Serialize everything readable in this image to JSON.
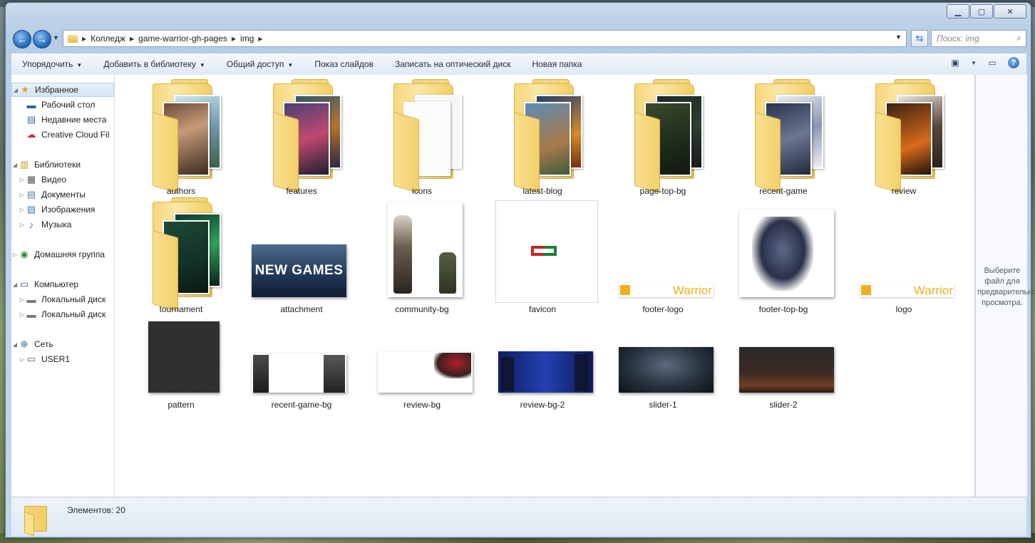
{
  "address": {
    "crumbs": [
      "Колледж",
      "game-warrior-gh-pages",
      "img"
    ]
  },
  "search": {
    "placeholder": "Поиск: img"
  },
  "toolbar": {
    "organize": "Упорядочить",
    "add_to_library": "Добавить в библиотеку",
    "share": "Общий доступ",
    "slideshow": "Показ слайдов",
    "burn": "Записать на оптический диск",
    "new_folder": "Новая папка"
  },
  "nav": {
    "favorites": "Избранное",
    "desktop": "Рабочий стол",
    "recent": "Недавние места",
    "creative_cloud": "Creative Cloud Fil",
    "libraries": "Библиотеки",
    "video": "Видео",
    "documents": "Документы",
    "images": "Изображения",
    "music": "Музыка",
    "homegroup": "Домашняя группа",
    "computer": "Компьютер",
    "local_disk_c": "Локальный диск",
    "local_disk_d": "Локальный диск",
    "network": "Сеть",
    "user1": "USER1"
  },
  "items": [
    {
      "name": "authors",
      "kind": "folder"
    },
    {
      "name": "features",
      "kind": "folder"
    },
    {
      "name": "icons",
      "kind": "folder"
    },
    {
      "name": "latest-blog",
      "kind": "folder"
    },
    {
      "name": "page-top-bg",
      "kind": "folder"
    },
    {
      "name": "recent-game",
      "kind": "folder"
    },
    {
      "name": "review",
      "kind": "folder"
    },
    {
      "name": "tournament",
      "kind": "folder"
    },
    {
      "name": "attachment",
      "kind": "image"
    },
    {
      "name": "community-bg",
      "kind": "image"
    },
    {
      "name": "favicon",
      "kind": "image"
    },
    {
      "name": "footer-logo",
      "kind": "image"
    },
    {
      "name": "footer-top-bg",
      "kind": "image"
    },
    {
      "name": "logo",
      "kind": "image"
    },
    {
      "name": "pattern",
      "kind": "image"
    },
    {
      "name": "recent-game-bg",
      "kind": "image"
    },
    {
      "name": "review-bg",
      "kind": "image"
    },
    {
      "name": "review-bg-2",
      "kind": "image"
    },
    {
      "name": "slider-1",
      "kind": "image"
    },
    {
      "name": "slider-2",
      "kind": "image"
    }
  ],
  "thumb_text": {
    "attachment_title": "NEW GAMES",
    "logo_word": "Warrior",
    "footer_logo_word": "Warrior"
  },
  "status": {
    "text": "Элементов: 20"
  },
  "preview": {
    "text": "Выберите файл для предварительного просмотра."
  }
}
